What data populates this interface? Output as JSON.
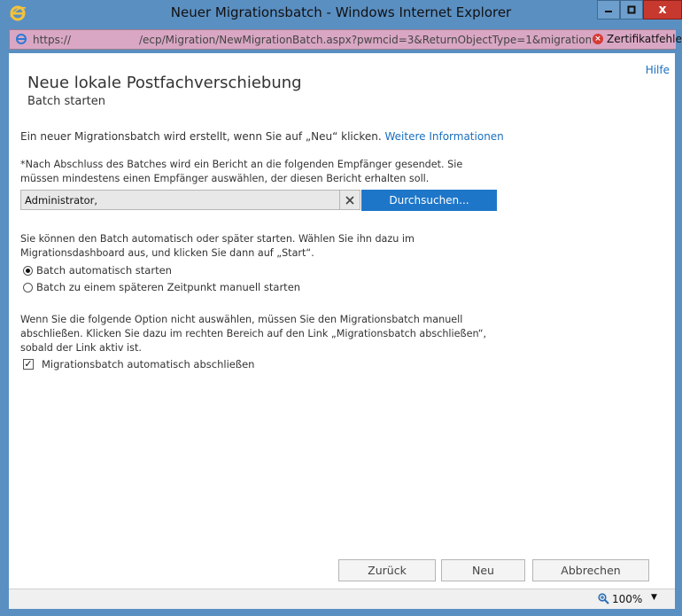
{
  "window": {
    "title": "Neuer Migrationsbatch - Windows Internet Explorer",
    "close_glyph": "x"
  },
  "address": {
    "protocol": "https://",
    "path": "/ecp/Migration/NewMigrationBatch.aspx?pwmcid=3&ReturnObjectType=1&migration=localmc",
    "cert_error": "Zertifikatfehler"
  },
  "page": {
    "help": "Hilfe",
    "title": "Neue lokale Postfachverschiebung",
    "subtitle": "Batch starten",
    "intro": "Ein neuer Migrationsbatch wird erstellt, wenn Sie auf „Neu“ klicken.",
    "intro_link": "Weitere Informationen",
    "report_note": "*Nach Abschluss des Batches wird ein Bericht an die folgenden Empfänger gesendet. Sie müssen mindestens einen Empfänger auswählen, der diesen Bericht erhalten soll.",
    "recipients_value": "Administrator,",
    "browse_label": "Durchsuchen...",
    "start_note": "Sie können den Batch automatisch oder später starten. Wählen Sie ihn dazu im Migrationsdashboard aus, und klicken Sie dann auf „Start“.",
    "radio_auto": "Batch automatisch starten",
    "radio_manual": "Batch zu einem späteren Zeitpunkt manuell starten",
    "complete_note": "Wenn Sie die folgende Option nicht auswählen, müssen Sie den Migrationsbatch manuell abschließen. Klicken Sie dazu im rechten Bereich auf den Link „Migrationsbatch abschließen“, sobald der Link aktiv ist.",
    "checkbox_label": "Migrationsbatch automatisch abschließen",
    "checkbox_checked": true,
    "radio_selected": "auto"
  },
  "buttons": {
    "back": "Zurück",
    "new": "Neu",
    "cancel": "Abbrechen"
  },
  "status": {
    "zoom": "100%"
  },
  "colors": {
    "frame": "#5a8fc2",
    "address_bg": "#d9a7c4",
    "accent": "#1e76c9",
    "link": "#1a6fbf"
  }
}
